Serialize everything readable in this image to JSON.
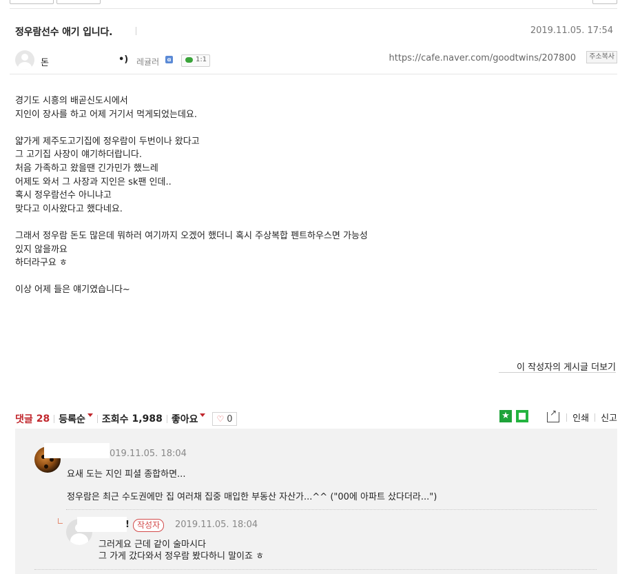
{
  "post": {
    "title": "정우람선수 애기 입니다.",
    "date": "2019.11.05. 17:54",
    "author": {
      "name": "돈",
      "name_suffix": "•)",
      "level": "레귤러",
      "chat_count": "1:1"
    },
    "url": "https://cafe.naver.com/goodtwins/207800",
    "copy_url_label": "주소복사",
    "body": [
      "경기도 시흥의 배곧신도시에서",
      "지인이 장사를 하고 어제 거기서 먹게되었는데요.",
      "",
      "얇가게 제주도고기집에 정우람이 두번이나 왔다고",
      "그 고기집 사장이 얘기하더랍니다.",
      "처음 가족하고 왔을땐 긴가민가 했느레",
      "어제도 와서 그 사장과 지인은 sk팬 인데..",
      "혹시 정우람선수 아니냐고",
      "맞다고 이사왔다고 했다네요.",
      "",
      "그래서 정우람 돈도 많은데 뭐하러 여기까지 오겠어 했더니 혹시 주상복합 펜트하우스면 가능성",
      "있지 않을까요",
      "하더라구요 ㅎ",
      "",
      "이상 어제 들은 얘기였습니다~"
    ],
    "more_posts_link": "이 작성자의 게시글 더보기"
  },
  "comment_bar": {
    "comments_label": "댓글",
    "comments_count": "28",
    "sort_label": "등록순",
    "views_label": "조회수",
    "views_count": "1,988",
    "like_label": "좋아요",
    "like_count": "0",
    "print_label": "인쇄",
    "report_label": "신고"
  },
  "comments": [
    {
      "date": "019.11.05. 18:04",
      "lines": [
        "요새 도는 지인 피셜 종합하면...",
        "정우람은 최근 수도권에만 집 여러채 집중 매입한 부동산 자산가...^^ (\"00에 아파트 샀다더라...\")"
      ]
    },
    {
      "name_suffix": "!",
      "writer_badge": "작성자",
      "date": "2019.11.05. 18:04",
      "lines": [
        "그러게요 근데 같이 술마시다",
        "그 가게 갔다와서 정우람 봤다하니 말이죠 ㅎ"
      ]
    }
  ],
  "colors": {
    "accent_red": "#c1272d",
    "share_green": "#1fa33a",
    "comment_bg": "#f2f2f2"
  }
}
